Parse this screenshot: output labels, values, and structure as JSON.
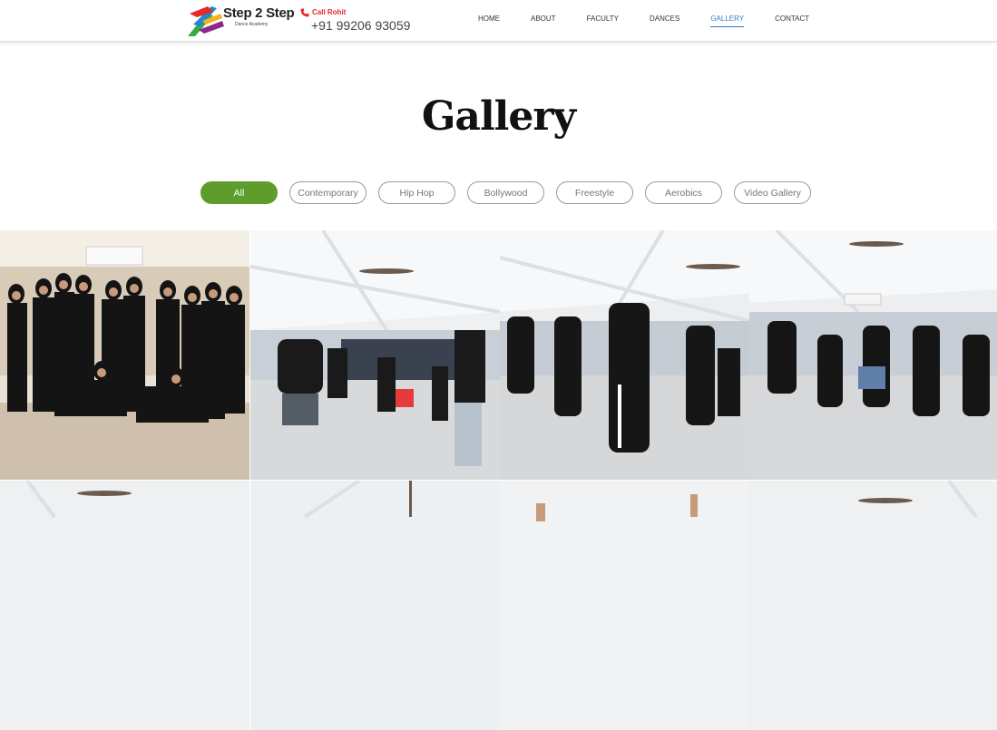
{
  "header": {
    "brand": "Step 2 Step",
    "brand_sub": "Dance Academy",
    "call_label": "Call Rohit",
    "phone": "+91 99206 93059"
  },
  "nav": {
    "items": [
      "HOME",
      "ABOUT",
      "FACULTY",
      "DANCES",
      "GALLERY",
      "CONTACT"
    ],
    "active": "GALLERY"
  },
  "page": {
    "title": "Gallery"
  },
  "filters": {
    "items": [
      "All",
      "Contemporary",
      "Hip Hop",
      "Bollywood",
      "Freestyle",
      "Aerobics",
      "Video Gallery"
    ],
    "active": "All"
  },
  "gallery": {
    "row1": [
      "group-photo",
      "hiphop-class-1",
      "hiphop-class-2",
      "hiphop-class-3"
    ],
    "row2": [
      "studio-ceiling-1",
      "studio-ceiling-2",
      "studio-ceiling-3",
      "studio-ceiling-4"
    ]
  },
  "colors": {
    "accent": "#5e9c2c",
    "nav_active": "#2b7fc8",
    "call": "#e8282b"
  }
}
